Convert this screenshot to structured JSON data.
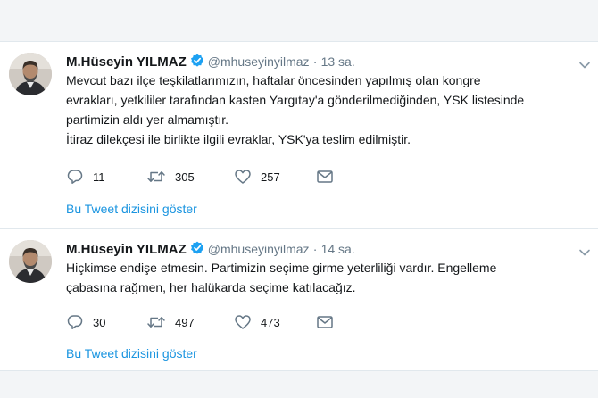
{
  "colors": {
    "accent": "#1b95e0",
    "verified": "#1da1f2",
    "text": "#14171a",
    "muted": "#657786",
    "divider": "#e1e8ed"
  },
  "tweets": [
    {
      "name": "M.Hüseyin YILMAZ",
      "verified_icon": "verified-badge-icon",
      "handle": "@mhuseyinyilmaz",
      "separator": "·",
      "time": "13 sa.",
      "lines": [
        "Mevcut bazı ilçe teşkilatlarımızın, haftalar öncesinden yapılmış olan kongre",
        "evrakları, yetkililer tarafından kasten Yargıtay'a gönderilmediğinden, YSK listesinde",
        "partimizin aldı yer almamıştır.",
        "İtiraz dilekçesi ile birlikte ilgili evraklar, YSK'ya teslim edilmiştir."
      ],
      "replies": "11",
      "retweets": "305",
      "likes": "257",
      "thread_link": "Bu Tweet dizisini göster"
    },
    {
      "name": "M.Hüseyin YILMAZ",
      "verified_icon": "verified-badge-icon",
      "handle": "@mhuseyinyilmaz",
      "separator": "·",
      "time": "14 sa.",
      "lines": [
        "Hiçkimse endişe etmesin.  Partimizin seçime girme yeterliliği vardır.  Engelleme",
        "çabasına rağmen, her halükarda seçime katılacağız."
      ],
      "replies": "30",
      "retweets": "497",
      "likes": "473",
      "thread_link": "Bu Tweet dizisini göster"
    }
  ]
}
